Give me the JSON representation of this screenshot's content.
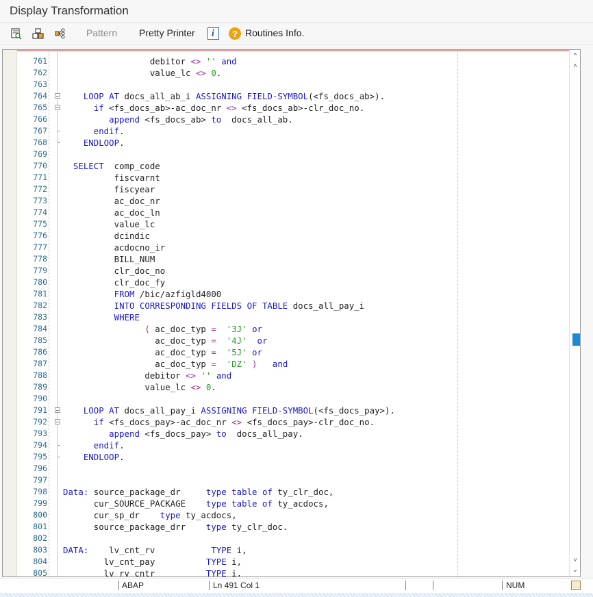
{
  "window": {
    "title": "Display Transformation"
  },
  "toolbar": {
    "icons": [
      "display-object-icon",
      "object-list-icon",
      "where-used-icon"
    ],
    "pattern_label": "Pattern",
    "pretty_printer_label": "Pretty Printer",
    "info_icon_glyph": "i",
    "help_icon_glyph": "?",
    "routines_info_label": "Routines Info."
  },
  "editor": {
    "language": "ABAP",
    "lines": [
      {
        "n": "761",
        "fold": "",
        "t": [
          [
            "txt",
            "                 debitor "
          ],
          [
            "op",
            "<>"
          ],
          [
            "txt",
            " "
          ],
          [
            "str",
            "''"
          ],
          [
            "txt",
            " "
          ],
          [
            "kw",
            "and"
          ]
        ]
      },
      {
        "n": "762",
        "fold": "",
        "t": [
          [
            "txt",
            "                 value_lc "
          ],
          [
            "op",
            "<>"
          ],
          [
            "txt",
            " "
          ],
          [
            "num",
            "0"
          ],
          [
            "txt",
            "."
          ]
        ]
      },
      {
        "n": "763",
        "fold": "",
        "t": []
      },
      {
        "n": "764",
        "fold": "box",
        "t": [
          [
            "txt",
            "    "
          ],
          [
            "kw",
            "LOOP AT"
          ],
          [
            "txt",
            " docs_all_ab_i "
          ],
          [
            "kw",
            "ASSIGNING FIELD-SYMBOL"
          ],
          [
            "txt",
            "(<fs_docs_ab>)."
          ]
        ]
      },
      {
        "n": "765",
        "fold": "box",
        "t": [
          [
            "txt",
            "      "
          ],
          [
            "kw",
            "if"
          ],
          [
            "txt",
            " <fs_docs_ab>-ac_doc_nr "
          ],
          [
            "op",
            "<>"
          ],
          [
            "txt",
            " <fs_docs_ab>-clr_doc_no."
          ]
        ]
      },
      {
        "n": "766",
        "fold": "",
        "t": [
          [
            "txt",
            "         "
          ],
          [
            "kw",
            "append"
          ],
          [
            "txt",
            " <fs_docs_ab> "
          ],
          [
            "kw",
            "to"
          ],
          [
            "txt",
            "  docs_all_ab."
          ]
        ]
      },
      {
        "n": "767",
        "fold": "tick",
        "t": [
          [
            "txt",
            "      "
          ],
          [
            "kw",
            "endif"
          ],
          [
            "txt",
            "."
          ]
        ]
      },
      {
        "n": "768",
        "fold": "tick",
        "t": [
          [
            "txt",
            "    "
          ],
          [
            "kw",
            "ENDLOOP"
          ],
          [
            "txt",
            "."
          ]
        ]
      },
      {
        "n": "769",
        "fold": "",
        "t": []
      },
      {
        "n": "770",
        "fold": "",
        "t": [
          [
            "txt",
            "  "
          ],
          [
            "kw",
            "SELECT"
          ],
          [
            "txt",
            "  comp_code"
          ]
        ]
      },
      {
        "n": "771",
        "fold": "",
        "t": [
          [
            "txt",
            "          fiscvarnt"
          ]
        ]
      },
      {
        "n": "772",
        "fold": "",
        "t": [
          [
            "txt",
            "          fiscyear"
          ]
        ]
      },
      {
        "n": "773",
        "fold": "",
        "t": [
          [
            "txt",
            "          ac_doc_nr"
          ]
        ]
      },
      {
        "n": "774",
        "fold": "",
        "t": [
          [
            "txt",
            "          ac_doc_ln"
          ]
        ]
      },
      {
        "n": "775",
        "fold": "",
        "t": [
          [
            "txt",
            "          value_lc"
          ]
        ]
      },
      {
        "n": "776",
        "fold": "",
        "t": [
          [
            "txt",
            "          dcindic"
          ]
        ]
      },
      {
        "n": "777",
        "fold": "",
        "t": [
          [
            "txt",
            "          acdocno_ir"
          ]
        ]
      },
      {
        "n": "778",
        "fold": "",
        "t": [
          [
            "txt",
            "          BILL_NUM"
          ]
        ]
      },
      {
        "n": "779",
        "fold": "",
        "t": [
          [
            "txt",
            "          clr_doc_no"
          ]
        ]
      },
      {
        "n": "780",
        "fold": "",
        "t": [
          [
            "txt",
            "          clr_doc_fy"
          ]
        ]
      },
      {
        "n": "781",
        "fold": "",
        "t": [
          [
            "txt",
            "          "
          ],
          [
            "kw",
            "FROM"
          ],
          [
            "txt",
            " /bic/azfigld4000"
          ]
        ]
      },
      {
        "n": "782",
        "fold": "",
        "t": [
          [
            "txt",
            "          "
          ],
          [
            "kw",
            "INTO CORRESPONDING FIELDS OF TABLE"
          ],
          [
            "txt",
            " docs_all_pay_i"
          ]
        ]
      },
      {
        "n": "783",
        "fold": "",
        "t": [
          [
            "txt",
            "          "
          ],
          [
            "kw",
            "WHERE"
          ]
        ]
      },
      {
        "n": "784",
        "fold": "",
        "t": [
          [
            "txt",
            "                "
          ],
          [
            "op",
            "("
          ],
          [
            "txt",
            " ac_doc_typ "
          ],
          [
            "op",
            "="
          ],
          [
            "txt",
            "  "
          ],
          [
            "str",
            "'3J'"
          ],
          [
            "txt",
            " "
          ],
          [
            "kw",
            "or"
          ]
        ]
      },
      {
        "n": "785",
        "fold": "",
        "t": [
          [
            "txt",
            "                  ac_doc_typ "
          ],
          [
            "op",
            "="
          ],
          [
            "txt",
            "  "
          ],
          [
            "str",
            "'4J'"
          ],
          [
            "txt",
            "  "
          ],
          [
            "kw",
            "or"
          ]
        ]
      },
      {
        "n": "786",
        "fold": "",
        "t": [
          [
            "txt",
            "                  ac_doc_typ "
          ],
          [
            "op",
            "="
          ],
          [
            "txt",
            "  "
          ],
          [
            "str",
            "'5J'"
          ],
          [
            "txt",
            " "
          ],
          [
            "kw",
            "or"
          ]
        ]
      },
      {
        "n": "787",
        "fold": "",
        "t": [
          [
            "txt",
            "                  ac_doc_typ "
          ],
          [
            "op",
            "="
          ],
          [
            "txt",
            "  "
          ],
          [
            "str",
            "'DZ'"
          ],
          [
            "txt",
            " "
          ],
          [
            "op",
            ")"
          ],
          [
            "txt",
            "   "
          ],
          [
            "kw",
            "and"
          ]
        ]
      },
      {
        "n": "788",
        "fold": "",
        "t": [
          [
            "txt",
            "                debitor "
          ],
          [
            "op",
            "<>"
          ],
          [
            "txt",
            " "
          ],
          [
            "str",
            "''"
          ],
          [
            "txt",
            " "
          ],
          [
            "kw",
            "and"
          ]
        ]
      },
      {
        "n": "789",
        "fold": "",
        "t": [
          [
            "txt",
            "                value_lc "
          ],
          [
            "op",
            "<>"
          ],
          [
            "txt",
            " "
          ],
          [
            "num",
            "0"
          ],
          [
            "txt",
            "."
          ]
        ]
      },
      {
        "n": "790",
        "fold": "",
        "t": []
      },
      {
        "n": "791",
        "fold": "box",
        "t": [
          [
            "txt",
            "    "
          ],
          [
            "kw",
            "LOOP AT"
          ],
          [
            "txt",
            " docs_all_pay_i "
          ],
          [
            "kw",
            "ASSIGNING FIELD-SYMBOL"
          ],
          [
            "txt",
            "(<fs_docs_pay>)."
          ]
        ]
      },
      {
        "n": "792",
        "fold": "box",
        "t": [
          [
            "txt",
            "      "
          ],
          [
            "kw",
            "if"
          ],
          [
            "txt",
            " <fs_docs_pay>-ac_doc_nr "
          ],
          [
            "op",
            "<>"
          ],
          [
            "txt",
            " <fs_docs_pay>-clr_doc_no."
          ]
        ]
      },
      {
        "n": "793",
        "fold": "",
        "t": [
          [
            "txt",
            "         "
          ],
          [
            "kw",
            "append"
          ],
          [
            "txt",
            " <fs_docs_pay> "
          ],
          [
            "kw",
            "to"
          ],
          [
            "txt",
            "  docs_all_pay."
          ]
        ]
      },
      {
        "n": "794",
        "fold": "tick",
        "t": [
          [
            "txt",
            "      "
          ],
          [
            "kw",
            "endif"
          ],
          [
            "txt",
            "."
          ]
        ]
      },
      {
        "n": "795",
        "fold": "tick",
        "t": [
          [
            "txt",
            "    "
          ],
          [
            "kw",
            "ENDLOOP"
          ],
          [
            "txt",
            "."
          ]
        ]
      },
      {
        "n": "796",
        "fold": "",
        "t": []
      },
      {
        "n": "797",
        "fold": "",
        "t": []
      },
      {
        "n": "798",
        "fold": "",
        "t": [
          [
            "kw",
            "Data:"
          ],
          [
            "txt",
            " source_package_dr     "
          ],
          [
            "kw",
            "type table of"
          ],
          [
            "txt",
            " ty_clr_doc,"
          ]
        ]
      },
      {
        "n": "799",
        "fold": "",
        "t": [
          [
            "txt",
            "      cur_SOURCE_PACKAGE    "
          ],
          [
            "kw",
            "type table of"
          ],
          [
            "txt",
            " ty_acdocs,"
          ]
        ]
      },
      {
        "n": "800",
        "fold": "",
        "t": [
          [
            "txt",
            "      cur_sp_dr    "
          ],
          [
            "kw",
            "type"
          ],
          [
            "txt",
            " ty_acdocs,"
          ]
        ]
      },
      {
        "n": "801",
        "fold": "",
        "t": [
          [
            "txt",
            "      source_package_drr    "
          ],
          [
            "kw",
            "type"
          ],
          [
            "txt",
            " ty_clr_doc."
          ]
        ]
      },
      {
        "n": "802",
        "fold": "",
        "t": []
      },
      {
        "n": "803",
        "fold": "",
        "t": [
          [
            "kw",
            "DATA:"
          ],
          [
            "txt",
            "    lv_cnt_rv           "
          ],
          [
            "kw",
            "TYPE"
          ],
          [
            "txt",
            " i,"
          ]
        ]
      },
      {
        "n": "804",
        "fold": "",
        "t": [
          [
            "txt",
            "        lv_cnt_pay          "
          ],
          [
            "kw",
            "TYPE"
          ],
          [
            "txt",
            " i,"
          ]
        ]
      },
      {
        "n": "805",
        "fold": "",
        "t": [
          [
            "txt",
            "        lv_rv_cntr          "
          ],
          [
            "kw",
            "TYPE"
          ],
          [
            "txt",
            " i,"
          ]
        ]
      }
    ]
  },
  "statusbar": {
    "language": "ABAP",
    "position": "Ln 491 Col  1",
    "mode": "NUM"
  },
  "colors": {
    "keyword": "#1a1ac8",
    "operator": "#9a2a9a",
    "string_literal": "#1e9a1e",
    "line_number": "#2e6b8a",
    "scroll_thumb": "#1b8ad6"
  }
}
